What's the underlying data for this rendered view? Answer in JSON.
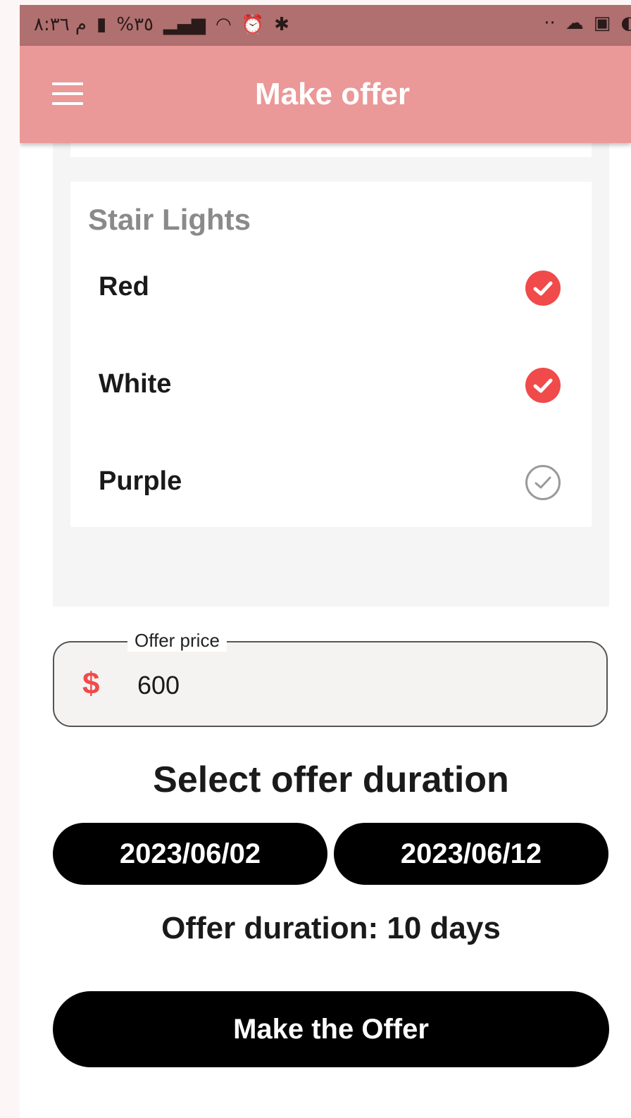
{
  "status_bar": {
    "time": "م ٨:٣٦",
    "battery": "%٣٥",
    "more": "··"
  },
  "app_bar": {
    "title": "Make offer",
    "menu_icon": "hamburger-menu-icon"
  },
  "options_card": {
    "title": "Stair Lights",
    "items": [
      {
        "label": "Red",
        "checked": true
      },
      {
        "label": "White",
        "checked": true
      },
      {
        "label": "Purple",
        "checked": false
      }
    ],
    "check_color": "#f04a4a"
  },
  "offer_price": {
    "label": "Offer price",
    "currency_symbol": "$",
    "value": "600"
  },
  "duration": {
    "title": "Select offer duration",
    "start_date": "2023/06/02",
    "end_date": "2023/06/12",
    "summary": "Offer duration: 10 days"
  },
  "submit": {
    "label": "Make the Offer"
  },
  "colors": {
    "app_bar": "#eb9898",
    "status_bar": "#b07070",
    "accent": "#f04a4a"
  }
}
